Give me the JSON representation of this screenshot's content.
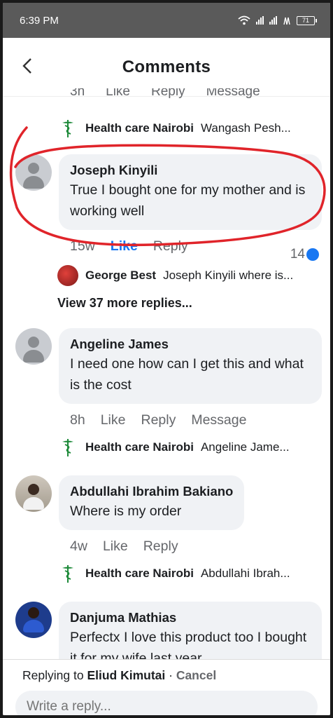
{
  "status_bar": {
    "time": "6:39 PM",
    "battery": "71"
  },
  "header": {
    "title": "Comments"
  },
  "cut_off_actions": [
    "3h",
    "Like",
    "Reply",
    "Message"
  ],
  "replies_previews": [
    {
      "author": "Health care Nairobi",
      "text": "Wangash Pesh..."
    },
    {
      "author": "George Best",
      "text": "Joseph Kinyili where is..."
    },
    {
      "author": "Health care Nairobi",
      "text": "Angeline Jame..."
    },
    {
      "author": "Health care Nairobi",
      "text": "Abdullahi Ibrah..."
    }
  ],
  "comments": [
    {
      "author": "Joseph Kinyili",
      "text": "True I bought one for my mother and is working well",
      "time": "15w",
      "like": "Like",
      "reply": "Reply",
      "reactions": "14"
    },
    {
      "author": "Angeline James",
      "text": "I need one  how can I get this and what is the cost",
      "time": "8h",
      "like": "Like",
      "reply": "Reply",
      "message": "Message"
    },
    {
      "author": "Abdullahi Ibrahim Bakiano",
      "text": "Where is my order",
      "time": "4w",
      "like": "Like",
      "reply": "Reply"
    },
    {
      "author": "Danjuma Mathias",
      "text": "Perfectx I love this product too I bought it for my wife last year"
    }
  ],
  "view_more": "View 37 more replies...",
  "footer": {
    "replying_prefix": "Replying to",
    "replying_to": "Eliud Kimutai",
    "separator": " · ",
    "cancel": "Cancel",
    "placeholder": "Write a reply..."
  },
  "colors": {
    "accent": "#1877f2",
    "annotation": "#e0242a",
    "bubble": "#f0f2f5"
  }
}
